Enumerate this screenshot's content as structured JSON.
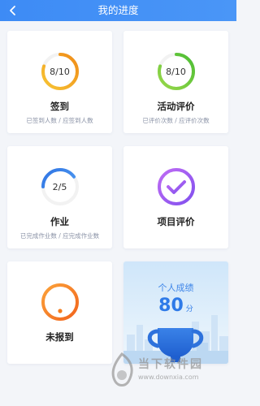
{
  "header": {
    "title": "我的进度",
    "back_icon": "chevron-left-icon"
  },
  "colors": {
    "header_blue": "#4a96f7",
    "sign_ring": "#f0a81c",
    "activity_ring": "#5fc53a",
    "homework_ring": "#3f86e8",
    "project_ring": "#a35bf0",
    "absent_ring": "#f47d1e",
    "score_blue": "#2e7ae8"
  },
  "cards": {
    "sign_in": {
      "progress_text": "8/10",
      "progress": 0.8,
      "title": "签到",
      "subtitle": "已签到人数 / 应签到人数"
    },
    "activity_eval": {
      "progress_text": "8/10",
      "progress": 0.8,
      "title": "活动评价",
      "subtitle": "已评价次数 / 应评价次数"
    },
    "homework": {
      "progress_text": "2/5",
      "progress": 0.4,
      "title": "作业",
      "subtitle": "已完成作业数 / 应完成作业数"
    },
    "project_eval": {
      "title": "项目评价",
      "icon": "check-icon"
    },
    "absent": {
      "title": "未报到",
      "icon": "exclamation-icon"
    },
    "score": {
      "label": "个人成绩",
      "value": "80",
      "unit": "分",
      "icon": "trophy-icon"
    }
  },
  "watermark": {
    "title": "当下软件园",
    "url": "www.downxia.com"
  }
}
